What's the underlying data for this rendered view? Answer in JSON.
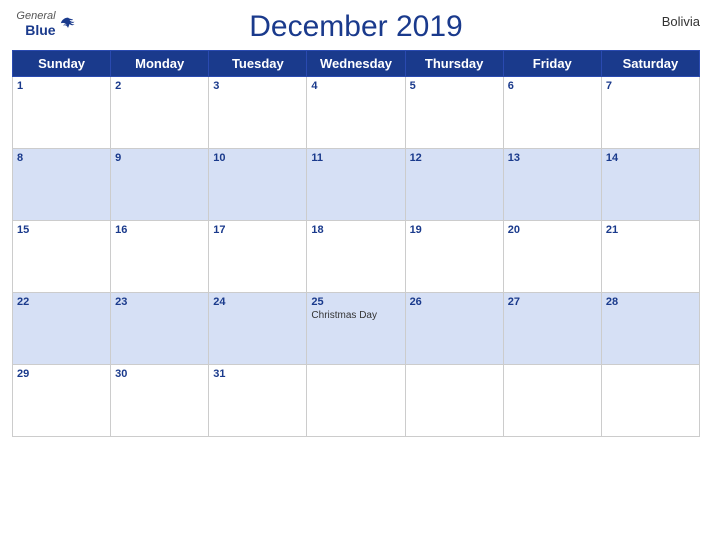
{
  "header": {
    "logo_general": "General",
    "logo_blue": "Blue",
    "title": "December 2019",
    "country": "Bolivia"
  },
  "weekdays": [
    "Sunday",
    "Monday",
    "Tuesday",
    "Wednesday",
    "Thursday",
    "Friday",
    "Saturday"
  ],
  "weeks": [
    [
      {
        "day": 1,
        "event": ""
      },
      {
        "day": 2,
        "event": ""
      },
      {
        "day": 3,
        "event": ""
      },
      {
        "day": 4,
        "event": ""
      },
      {
        "day": 5,
        "event": ""
      },
      {
        "day": 6,
        "event": ""
      },
      {
        "day": 7,
        "event": ""
      }
    ],
    [
      {
        "day": 8,
        "event": ""
      },
      {
        "day": 9,
        "event": ""
      },
      {
        "day": 10,
        "event": ""
      },
      {
        "day": 11,
        "event": ""
      },
      {
        "day": 12,
        "event": ""
      },
      {
        "day": 13,
        "event": ""
      },
      {
        "day": 14,
        "event": ""
      }
    ],
    [
      {
        "day": 15,
        "event": ""
      },
      {
        "day": 16,
        "event": ""
      },
      {
        "day": 17,
        "event": ""
      },
      {
        "day": 18,
        "event": ""
      },
      {
        "day": 19,
        "event": ""
      },
      {
        "day": 20,
        "event": ""
      },
      {
        "day": 21,
        "event": ""
      }
    ],
    [
      {
        "day": 22,
        "event": ""
      },
      {
        "day": 23,
        "event": ""
      },
      {
        "day": 24,
        "event": ""
      },
      {
        "day": 25,
        "event": "Christmas Day"
      },
      {
        "day": 26,
        "event": ""
      },
      {
        "day": 27,
        "event": ""
      },
      {
        "day": 28,
        "event": ""
      }
    ],
    [
      {
        "day": 29,
        "event": ""
      },
      {
        "day": 30,
        "event": ""
      },
      {
        "day": 31,
        "event": ""
      },
      {
        "day": null,
        "event": ""
      },
      {
        "day": null,
        "event": ""
      },
      {
        "day": null,
        "event": ""
      },
      {
        "day": null,
        "event": ""
      }
    ]
  ],
  "colors": {
    "header_bg": "#1a3a8c",
    "row_blue": "#d6e0f5",
    "row_white": "#ffffff",
    "day_number_color": "#1a3a8c",
    "border_color": "#cccccc",
    "event_color": "#333333"
  }
}
